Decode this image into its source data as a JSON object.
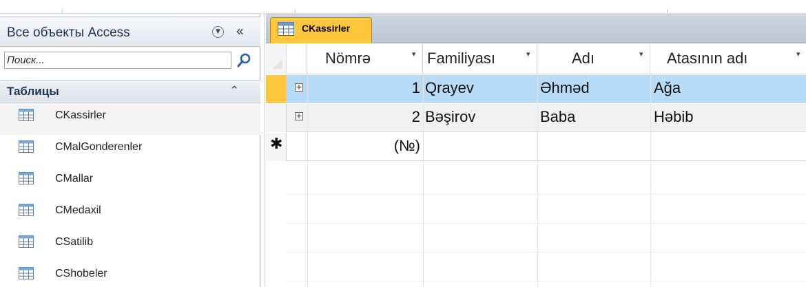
{
  "nav": {
    "title": "Все объекты Access",
    "search_placeholder": "Поиск...",
    "group_title": "Таблицы",
    "items": [
      {
        "label": "CKassirler"
      },
      {
        "label": "CMalGonderenler"
      },
      {
        "label": "CMallar"
      },
      {
        "label": "CMedaxil"
      },
      {
        "label": "CSatilib"
      },
      {
        "label": "CShobeler"
      }
    ]
  },
  "tab": {
    "label": "CKassirler"
  },
  "grid": {
    "columns": [
      "Nömrə",
      "Familiyası",
      "Adı",
      "Atasının adı"
    ],
    "rows": [
      {
        "nomre": "1",
        "familiya": "Qrayev",
        "ad": "Əhməd",
        "ata": "Ağa"
      },
      {
        "nomre": "2",
        "familiya": "Bəşirov",
        "ad": "Baba",
        "ata": "Həbib"
      }
    ],
    "new_row_placeholder": "(№)"
  },
  "icons": {
    "table": "table-icon",
    "search": "search-icon",
    "dropdown": "chevron-circle-down-icon",
    "collapse": "double-chevron-left-icon",
    "group_collapse": "double-chevron-up-icon"
  },
  "colors": {
    "accent_tab": "#ffc73d",
    "selected_row": "#b8dcf8"
  }
}
